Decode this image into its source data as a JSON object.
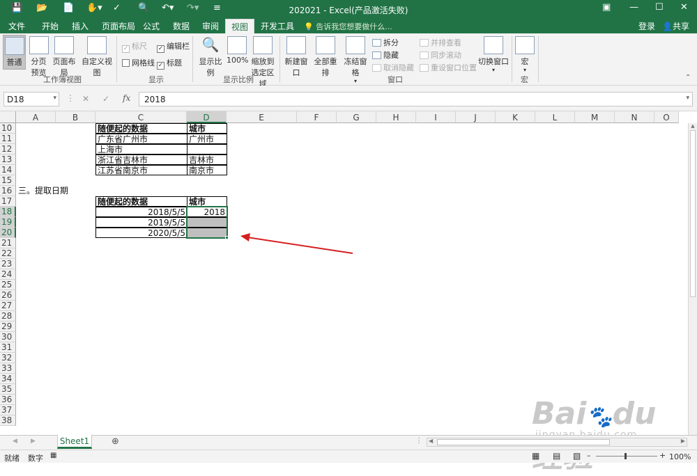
{
  "title": "202021 - Excel(产品激活失败)",
  "tabs": [
    {
      "label": "文件",
      "active": false
    },
    {
      "label": "开始",
      "active": false
    },
    {
      "label": "插入",
      "active": false
    },
    {
      "label": "页面布局",
      "active": false
    },
    {
      "label": "公式",
      "active": false
    },
    {
      "label": "数据",
      "active": false
    },
    {
      "label": "审阅",
      "active": false
    },
    {
      "label": "视图",
      "active": true
    },
    {
      "label": "开发工具",
      "active": false
    }
  ],
  "tell_me": "告诉我您想要做什么...",
  "login": "登录",
  "share": "共享",
  "ribbon": {
    "normal": "普通",
    "page_break": [
      "分页",
      "预览"
    ],
    "page_layout": "页面布局",
    "custom_view": "自定义视图",
    "group_workbook_views": "工作簿视图",
    "ruler": "标尺",
    "formula_bar": "编辑栏",
    "gridlines": "网格线",
    "headings": "标题",
    "group_show": "显示",
    "zoom": "显示比例",
    "zoom100": "100%",
    "zoom_selection": [
      "缩放到",
      "选定区域"
    ],
    "group_zoom": "显示比例",
    "new_window": "新建窗口",
    "arrange_all": "全部重排",
    "freeze_panes": "冻结窗格",
    "split": "拆分",
    "hide": "隐藏",
    "unhide": "取消隐藏",
    "side_by_side": "并排查看",
    "sync_scroll": "同步滚动",
    "reset_position": "重设窗口位置",
    "switch_windows": "切换窗口",
    "group_window": "窗口",
    "macros": "宏",
    "group_macros": "宏"
  },
  "formula_bar": {
    "name_box": "D18",
    "content": "2018"
  },
  "columns": [
    "A",
    "B",
    "C",
    "D",
    "E",
    "F",
    "G",
    "H",
    "I",
    "J",
    "K",
    "L",
    "M",
    "N",
    "O"
  ],
  "rows": [
    "10",
    "11",
    "12",
    "13",
    "14",
    "15",
    "16",
    "17",
    "18",
    "19",
    "20",
    "21",
    "22",
    "23",
    "24",
    "25",
    "26",
    "27",
    "28",
    "29",
    "30",
    "31",
    "32",
    "33",
    "34",
    "35",
    "36",
    "37",
    "38"
  ],
  "selected_cell": "D18",
  "table1": {
    "header": [
      "随便起的数据",
      "城市"
    ],
    "rows": [
      [
        "广东省广州市",
        "广州市"
      ],
      [
        "上海市",
        ""
      ],
      [
        "浙江省吉林市",
        "吉林市"
      ],
      [
        "江苏省南京市",
        "南京市"
      ]
    ]
  },
  "section3_title": "三。提取日期",
  "table2": {
    "header": [
      "随便起的数据",
      "城市"
    ],
    "rows": [
      [
        "2018/5/5",
        "2018"
      ],
      [
        "2019/5/5",
        ""
      ],
      [
        "2020/5/5",
        ""
      ]
    ]
  },
  "sheet_tab": "Sheet1",
  "status": {
    "ready": "就绪",
    "mode": "数字",
    "zoom": "100%"
  },
  "colors": {
    "excel_green": "#217346",
    "arrow_red": "#d42020"
  }
}
